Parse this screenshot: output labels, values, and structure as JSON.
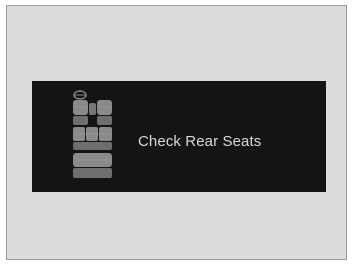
{
  "display": {
    "message": "Check Rear Seats",
    "message_color": "#d8d8d8",
    "panel_color": "#141414",
    "background_color": "#dcdcdc",
    "icon": "rear-seats-icon"
  }
}
